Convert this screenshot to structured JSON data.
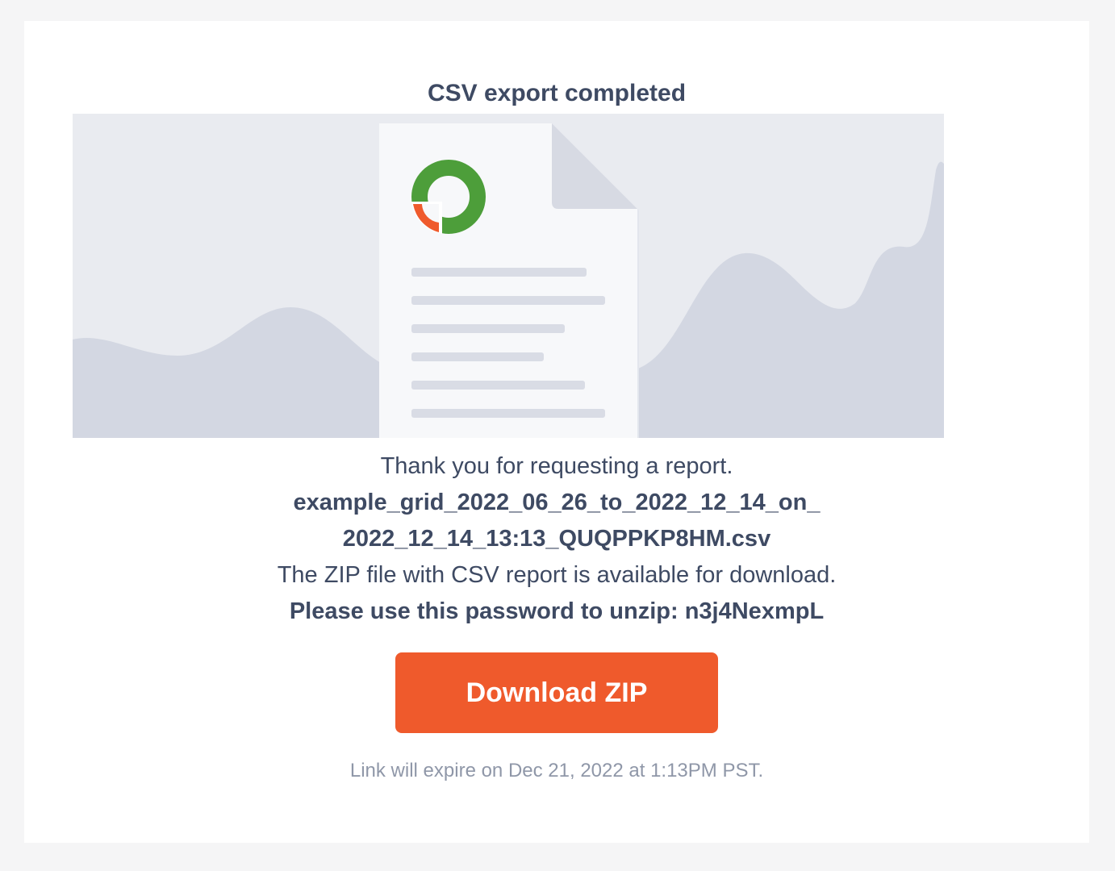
{
  "email": {
    "title": "CSV export completed",
    "hero_image": {
      "icon": "csv-document-illustration",
      "logo_colors": {
        "ring": "#4d9e3a",
        "segment": "#ef5a2c"
      }
    },
    "message": {
      "thanks": "Thank you for requesting a report.",
      "filename_line1": "example_grid_2022_06_26_to_2022_12_14_on_",
      "filename_line2": "2022_12_14_13:13_QUQPPKP8HM.csv",
      "zip_available": "The ZIP file with CSV report is available for download.",
      "password_line": "Please use this password to unzip: n3j4NexmpL"
    },
    "download_button": {
      "label": "Download ZIP",
      "color": "#ef5a2c"
    },
    "expiry_note": "Link will expire on Dec 21, 2022 at 1:13PM PST."
  }
}
